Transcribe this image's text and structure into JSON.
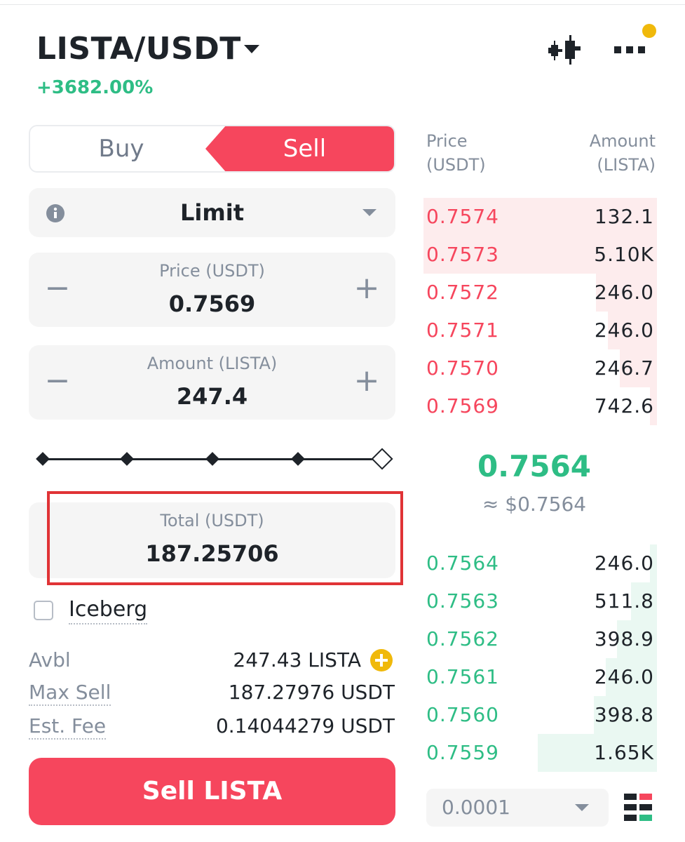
{
  "header": {
    "pair": "LISTA/USDT",
    "change": "+3682.00%"
  },
  "tabs": {
    "buy": "Buy",
    "sell": "Sell"
  },
  "order_type": {
    "selected": "Limit"
  },
  "price_field": {
    "label": "Price (USDT)",
    "value": "0.7569"
  },
  "amount_field": {
    "label": "Amount (LISTA)",
    "value": "247.4"
  },
  "slider": {
    "fraction": 1.0
  },
  "total_field": {
    "label": "Total (USDT)",
    "value": "187.25706"
  },
  "iceberg": {
    "label": "Iceberg",
    "checked": false
  },
  "balances": {
    "avbl_label": "Avbl",
    "avbl_value": "247.43 LISTA",
    "maxsell_label": "Max Sell",
    "maxsell_value": "187.27976 USDT",
    "fee_label": "Est. Fee",
    "fee_value": "0.14044279 USDT"
  },
  "action_button": "Sell LISTA",
  "orderbook": {
    "price_header": [
      "Price",
      "(USDT)"
    ],
    "amount_header": [
      "Amount",
      "(LISTA)"
    ],
    "asks": [
      {
        "price": "0.7574",
        "amount": "132.1",
        "depth": 1.0
      },
      {
        "price": "0.7573",
        "amount": "5.10K",
        "depth": 1.0
      },
      {
        "price": "0.7572",
        "amount": "246.0",
        "depth": 0.26
      },
      {
        "price": "0.7571",
        "amount": "246.0",
        "depth": 0.21
      },
      {
        "price": "0.7570",
        "amount": "246.7",
        "depth": 0.16
      },
      {
        "price": "0.7569",
        "amount": "742.6",
        "depth": 0.03
      }
    ],
    "mid_price": "0.7564",
    "mid_usd": "≈ $0.7564",
    "bids": [
      {
        "price": "0.7564",
        "amount": "246.0",
        "depth": 0.03
      },
      {
        "price": "0.7563",
        "amount": "511.8",
        "depth": 0.11
      },
      {
        "price": "0.7562",
        "amount": "398.9",
        "depth": 0.17
      },
      {
        "price": "0.7561",
        "amount": "246.0",
        "depth": 0.22
      },
      {
        "price": "0.7560",
        "amount": "398.8",
        "depth": 0.27
      },
      {
        "price": "0.7559",
        "amount": "1.65K",
        "depth": 0.51
      }
    ],
    "tick_size": "0.0001"
  },
  "colors": {
    "sell": "#f6465d",
    "buy": "#2ebd85",
    "accent": "#f0b90b"
  },
  "icons": [
    "chart-icon",
    "more-icon",
    "info-icon",
    "plus-circle-icon",
    "layout-icon"
  ]
}
